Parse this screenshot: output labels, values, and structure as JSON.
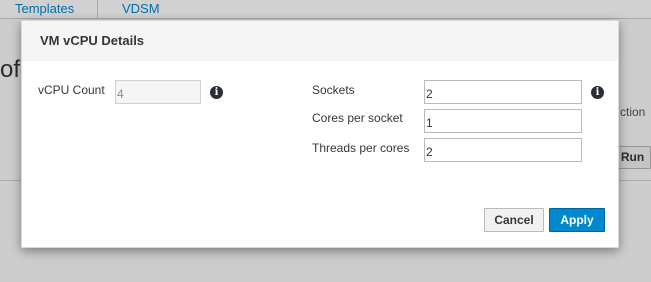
{
  "background": {
    "tabs": [
      "Templates",
      "VDSM"
    ],
    "heading_fragment": "of (",
    "action_fragment": "ction",
    "run_button": "Run"
  },
  "dialog": {
    "title": "VM vCPU Details",
    "vcpu_count": {
      "label": "vCPU Count",
      "value": "4",
      "disabled": true,
      "info_icon": "info-icon"
    },
    "sockets": {
      "label": "Sockets",
      "value": "2",
      "info_icon": "info-icon"
    },
    "cores_per_socket": {
      "label": "Cores per socket",
      "value": "1"
    },
    "threads_per_cores": {
      "label": "Threads per cores",
      "value": "2"
    },
    "buttons": {
      "cancel": "Cancel",
      "apply": "Apply"
    }
  },
  "colors": {
    "primary": "#0088ce",
    "header_bg": "#f5f5f5",
    "link": "#0088ce"
  }
}
